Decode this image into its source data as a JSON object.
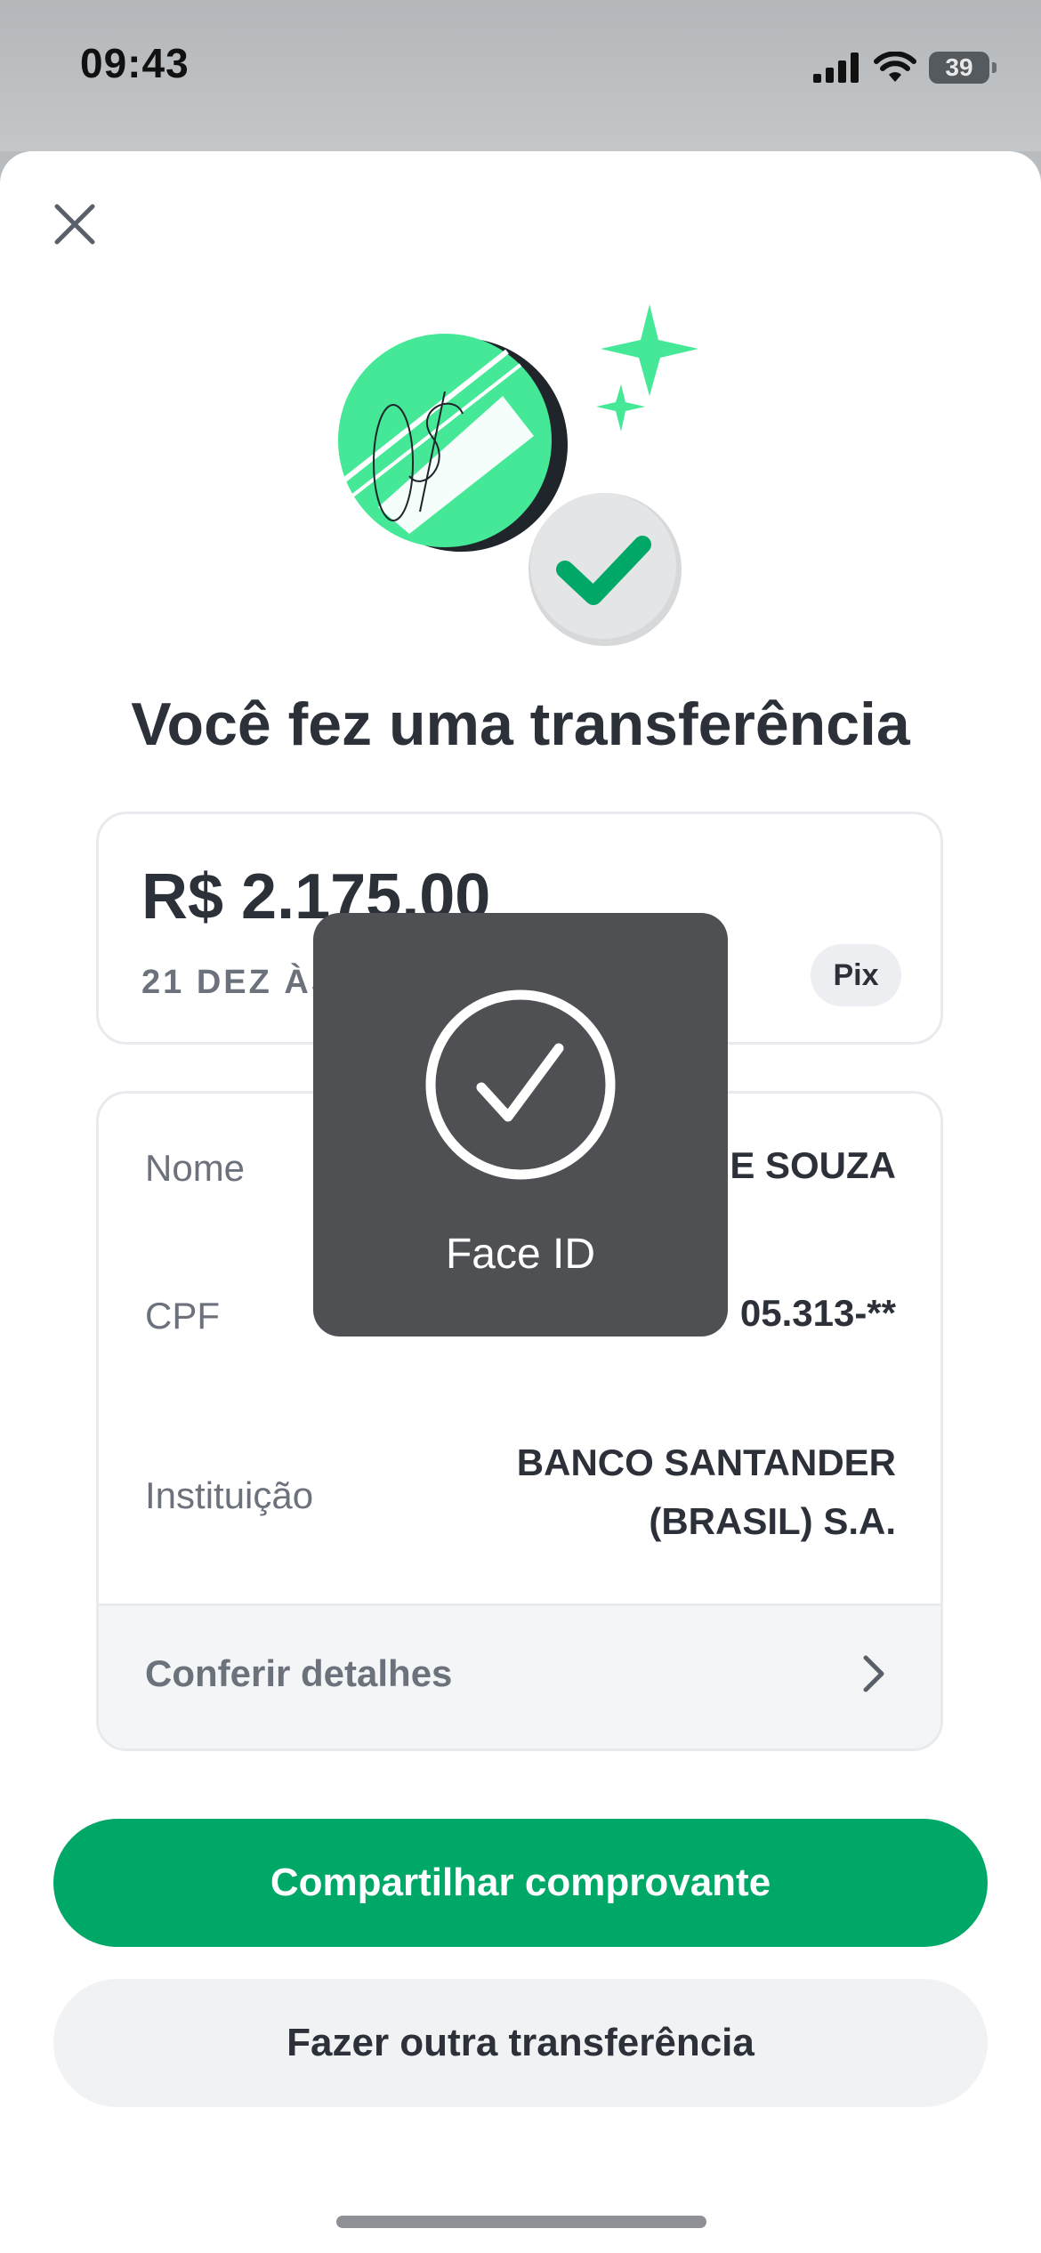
{
  "status_bar": {
    "time": "09:43",
    "battery": "39"
  },
  "title": "Você fez uma transferência",
  "amount_card": {
    "amount": "R$ 2.175,00",
    "date": "21 DEZ ÀS",
    "method_badge": "Pix"
  },
  "details": {
    "rows": [
      {
        "label": "Nome",
        "value": "E SOUZA"
      },
      {
        "label": "CPF",
        "value": "05.313-**"
      },
      {
        "label": "Instituição",
        "value_line1": "BANCO SANTANDER",
        "value_line2": "(BRASIL) S.A."
      }
    ],
    "footer_label": "Conferir detalhes"
  },
  "buttons": {
    "share": "Compartilhar comprovante",
    "new_transfer": "Fazer outra transferência"
  },
  "face_id": {
    "label": "Face ID"
  },
  "colors": {
    "accent": "#00a868",
    "hero_green": "#45e897",
    "hero_dark": "#1f252b",
    "text_primary": "#2b3039",
    "text_secondary": "#6c727c"
  }
}
